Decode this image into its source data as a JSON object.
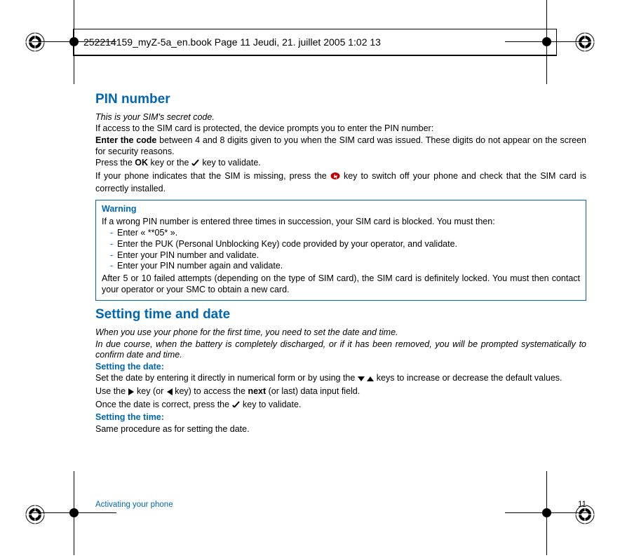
{
  "header_line": "252214159_myZ-5a_en.book  Page 11  Jeudi, 21. juillet 2005  1:02 13",
  "pin": {
    "title": "PIN number",
    "intro_italic": "This is your SIM's secret code.",
    "p1": "If access to the SIM card is protected, the device prompts you to enter the PIN number:",
    "p2a": "Enter the code",
    "p2b": " between 4 and 8 digits given to you when the SIM card was issued. These digits do not appear on the screen for security reasons.",
    "p3a": "Press the ",
    "p3b": "OK",
    "p3c": " key or the ",
    "p3d": " key to validate.",
    "p4a": "If your phone indicates that the SIM is missing, press the ",
    "p4b": " key to switch off your phone and check that the SIM card is correctly installed."
  },
  "warning": {
    "title": "Warning",
    "lead": "If a wrong PIN number is entered three times in succession, your SIM card is blocked. You must then:",
    "items": [
      "Enter « **05* ».",
      "Enter the PUK (Personal Unblocking Key) code provided by your operator, and validate.",
      "Enter your PIN number and validate.",
      "Enter your PIN number again and validate."
    ],
    "tail": "After 5 or 10 failed attempts (depending on the type of SIM card), the SIM card is definitely locked. You must then contact your operator or your SMC to obtain a new card."
  },
  "datetime": {
    "title": "Setting time and date",
    "intro1": "When you use your phone for the first time, you need to set the date and time.",
    "intro2": "In due course, when the battery is completely discharged, or if it has been removed, you will be prompted systematically to confirm date and time.",
    "date_heading": "Setting the date:",
    "date_p1a": "Set the date by entering it directly in numerical form or by using the ",
    "date_p1b": " keys to increase or decrease the default values.",
    "date_p2a": "Use the ",
    "date_p2b": " key (or ",
    "date_p2c": " key) to access the ",
    "date_p2d": "next",
    "date_p2e": " (or last) data input field.",
    "date_p3a": "Once the date is correct, press the ",
    "date_p3b": " key to validate.",
    "time_heading": "Setting the time:",
    "time_p1": "Same procedure as for setting the date."
  },
  "footer": {
    "section": "Activating your phone",
    "page": "11"
  }
}
